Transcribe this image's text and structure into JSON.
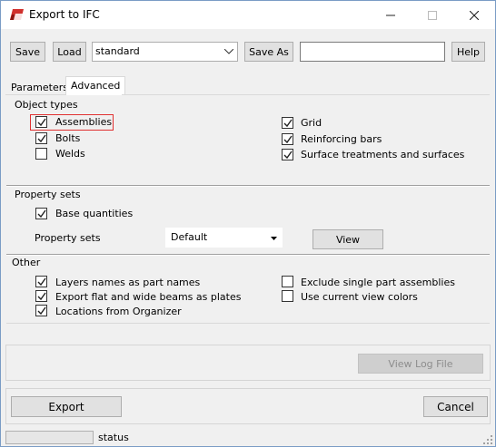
{
  "window": {
    "title": "Export to IFC"
  },
  "toolbar": {
    "save_label": "Save",
    "load_label": "Load",
    "settings_value": "standard",
    "save_as_label": "Save As",
    "save_as_value": "",
    "help_label": "Help"
  },
  "tabs": [
    {
      "label": "Parameters",
      "active": false
    },
    {
      "label": "Advanced",
      "active": true
    }
  ],
  "object_types": {
    "title": "Object types",
    "left": [
      {
        "label": "Assemblies",
        "checked": true
      },
      {
        "label": "Bolts",
        "checked": true
      },
      {
        "label": "Welds",
        "checked": false
      }
    ],
    "right": [
      {
        "label": "Grid",
        "checked": true
      },
      {
        "label": "Reinforcing bars",
        "checked": true
      },
      {
        "label": "Surface treatments and surfaces",
        "checked": true
      }
    ]
  },
  "property_sets": {
    "title": "Property sets",
    "base_quantities": {
      "label": "Base quantities",
      "checked": true
    },
    "property_sets_label": "Property sets",
    "property_sets_value": "Default",
    "view_label": "View"
  },
  "other": {
    "title": "Other",
    "left": [
      {
        "label": "Layers names as part names",
        "checked": true
      },
      {
        "label": "Export flat and wide beams as plates",
        "checked": true
      },
      {
        "label": "Locations from Organizer",
        "checked": true
      }
    ],
    "right": [
      {
        "label": "Exclude single part assemblies",
        "checked": false
      },
      {
        "label": "Use current view colors",
        "checked": false
      }
    ]
  },
  "log": {
    "view_log_label": "View Log File"
  },
  "footer": {
    "export_label": "Export",
    "cancel_label": "Cancel",
    "status_text": "status"
  },
  "colors": {
    "highlight": "#e03131",
    "app_icon_red": "#d0302c"
  }
}
